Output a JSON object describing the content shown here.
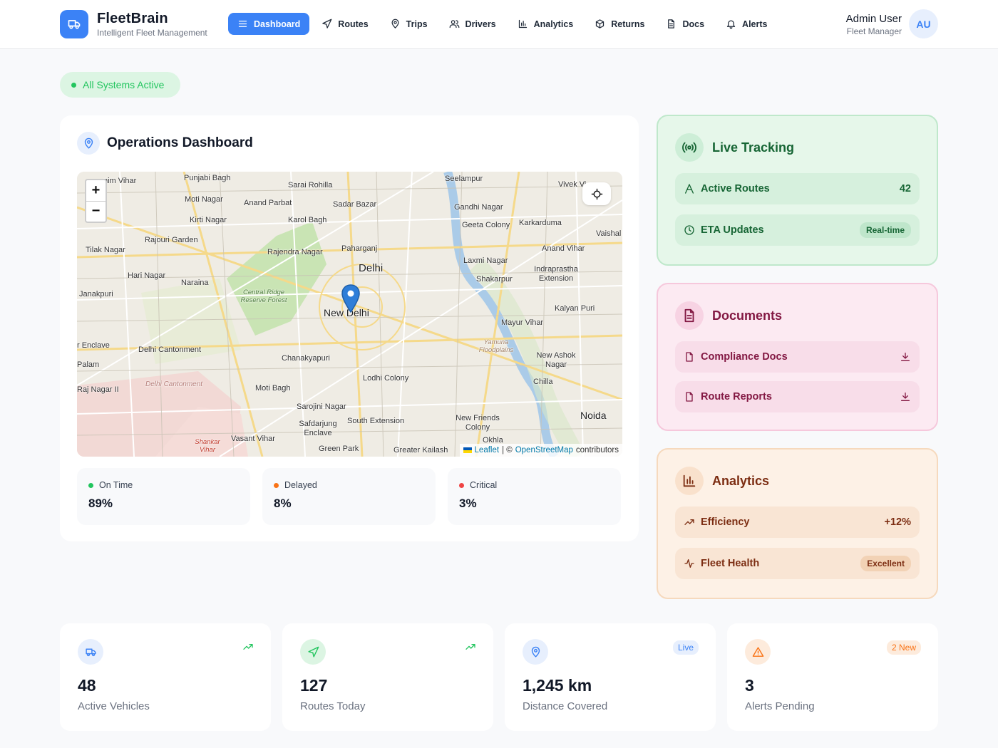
{
  "brand": {
    "name": "FleetBrain",
    "subtitle": "Intelligent Fleet Management",
    "icon": "truck-icon"
  },
  "nav": [
    {
      "label": "Dashboard",
      "icon": "menu-icon",
      "active": true
    },
    {
      "label": "Routes",
      "icon": "navigation-icon"
    },
    {
      "label": "Trips",
      "icon": "map-pin-icon"
    },
    {
      "label": "Drivers",
      "icon": "users-icon"
    },
    {
      "label": "Analytics",
      "icon": "bar-chart-icon"
    },
    {
      "label": "Returns",
      "icon": "package-icon"
    },
    {
      "label": "Docs",
      "icon": "file-text-icon"
    },
    {
      "label": "Alerts",
      "icon": "bell-icon"
    }
  ],
  "user": {
    "name": "Admin User",
    "role": "Fleet Manager",
    "initials": "AU"
  },
  "status": {
    "label": "All Systems Active",
    "color": "#22c55e"
  },
  "ops": {
    "title": "Operations Dashboard",
    "map": {
      "zoom_in": "+",
      "zoom_out": "−",
      "attribution": {
        "leaflet": "Leaflet",
        "sep": "| ©",
        "osm": "OpenStreetMap",
        "suffix": "contributors"
      },
      "labels": {
        "punjabi_bagh": "Punjabi Bagh",
        "sarai_rohilla": "Sarai Rohilla",
        "seelampur": "Seelampur",
        "vivek_vihar": "Vivek Vi",
        "moti_nagar": "Moti Nagar",
        "anand_parbat": "Anand Parbat",
        "sadar_bazar": "Sadar Bazar",
        "gandhi_nagar": "Gandhi Nagar",
        "kirti_nagar": "Kirti Nagar",
        "karol_bagh": "Karol Bagh",
        "geeta_colony": "Geeta Colony",
        "karkarduma": "Karkarduma",
        "rajouri_garden": "Rajouri Garden",
        "vaishali": "Vaishal",
        "tilak_nagar": "Tilak Nagar",
        "rajendra_nagar": "Rajendra Nagar",
        "paharganj": "Paharganj",
        "anand_vihar": "Anand Vihar",
        "delhi": "Delhi",
        "laxmi_nagar": "Laxmi Nagar",
        "hari_nagar": "Hari Nagar",
        "indraprastha": "Indraprastha Extension",
        "naraina": "Naraina",
        "shakarpur": "Shakarpur",
        "janakpuri": "Janakpuri",
        "ridge_forest": "Central Ridge Reserve Forest",
        "new_delhi": "New Delhi",
        "kalyan_puri": "Kalyan Puri",
        "mayur_vihar": "Mayur Vihar",
        "yamuna": "Yamuna Floodplains",
        "enclave": "r Enclave",
        "delhi_cantonment": "Delhi Cantonment",
        "new_ashok_nagar": "New Ashok Nagar",
        "palam": "Palam",
        "chanakyapuri": "Chanakyapuri",
        "delhi_cant_area": "Delhi Cantonment",
        "raj_nagar": "Raj Nagar II",
        "lodhi_colony": "Lodhi Colony",
        "chilla": "Chilla",
        "moti_bagh": "Moti Bagh",
        "sarojini_nagar": "Sarojini Nagar",
        "noida": "Noida",
        "safdarjung": "Safdarjung Enclave",
        "south_ext": "South Extension",
        "new_friends": "New Friends Colony",
        "shankar_vihar": "Shankar Vihar",
        "vasant_vihar": "Vasant Vihar",
        "green_park": "Green Park",
        "greater_kailash": "Greater Kailash",
        "okhla": "Okhla",
        "nim_vihar": "nim Vihar"
      }
    },
    "kpis": [
      {
        "label": "On Time",
        "value": "89%",
        "color": "#22c55e"
      },
      {
        "label": "Delayed",
        "value": "8%",
        "color": "#f97316"
      },
      {
        "label": "Critical",
        "value": "3%",
        "color": "#ef4444"
      }
    ]
  },
  "live": {
    "title": "Live Tracking",
    "icon": "radio-icon",
    "rows": [
      {
        "label": "Active Routes",
        "value": "42",
        "icon": "route-icon"
      },
      {
        "label": "ETA Updates",
        "badge": "Real-time",
        "icon": "clock-icon"
      }
    ]
  },
  "docs": {
    "title": "Documents",
    "icon": "file-text-icon",
    "rows": [
      {
        "label": "Compliance Docs",
        "icon": "file-icon",
        "action": "download-icon"
      },
      {
        "label": "Route Reports",
        "icon": "file-icon",
        "action": "download-icon"
      }
    ]
  },
  "analytics": {
    "title": "Analytics",
    "icon": "bar-chart-icon",
    "rows": [
      {
        "label": "Efficiency",
        "value": "+12%",
        "icon": "trending-up-icon"
      },
      {
        "label": "Fleet Health",
        "badge": "Excellent",
        "icon": "activity-icon"
      }
    ]
  },
  "stats": [
    {
      "value": "48",
      "label": "Active Vehicles",
      "icon": "truck-icon",
      "indicator": "trending-up-icon",
      "color": "#3b82f6"
    },
    {
      "value": "127",
      "label": "Routes Today",
      "icon": "navigation-icon",
      "indicator": "trending-up-icon",
      "color": "#22c55e"
    },
    {
      "value": "1,245 km",
      "label": "Distance Covered",
      "icon": "map-pin-icon",
      "badge": "Live",
      "color": "#3b82f6"
    },
    {
      "value": "3",
      "label": "Alerts Pending",
      "icon": "alert-triangle-icon",
      "badge": "2 New",
      "color": "#f97316"
    }
  ]
}
